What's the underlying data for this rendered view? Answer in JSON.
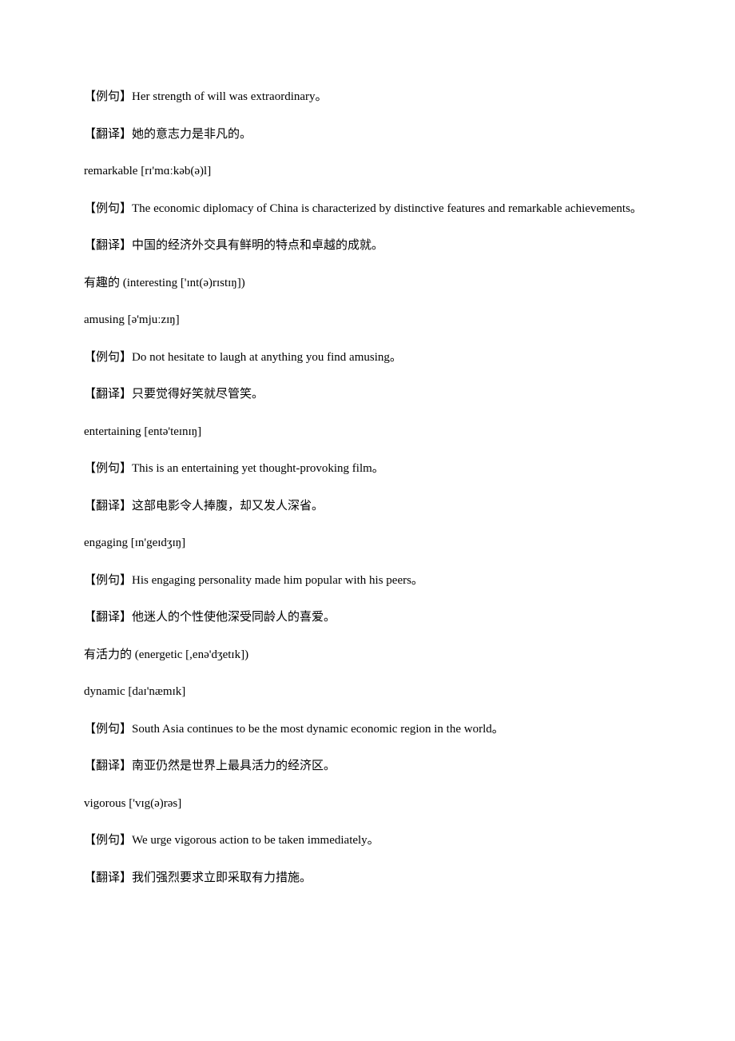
{
  "lines": [
    "【例句】Her strength of will was extraordinary。",
    "【翻译】她的意志力是非凡的。",
    "remarkable [rɪ'mɑːkəb(ə)l]",
    "【例句】The economic diplomacy of China is characterized by distinctive features and remarkable achievements。",
    "【翻译】中国的经济外交具有鲜明的特点和卓越的成就。",
    "有趣的 (interesting ['ɪnt(ə)rɪstɪŋ])",
    "amusing [ə'mjuːzɪŋ]",
    "【例句】Do not hesitate to laugh at anything you find amusing。",
    "【翻译】只要觉得好笑就尽管笑。",
    "entertaining [entə'teɪnɪŋ]",
    "【例句】This is an entertaining yet thought-provoking film。",
    "【翻译】这部电影令人捧腹，却又发人深省。",
    "engaging [ɪn'geɪdʒɪŋ]",
    "【例句】His engaging personality made him popular with his peers。",
    "【翻译】他迷人的个性使他深受同龄人的喜爱。",
    "有活力的 (energetic [,enə'dʒetɪk])",
    "dynamic [daɪ'næmɪk]",
    "【例句】South Asia continues to be the most dynamic economic region in the world。",
    "【翻译】南亚仍然是世界上最具活力的经济区。",
    "vigorous ['vɪg(ə)rəs]",
    "【例句】We urge vigorous action to be taken immediately。",
    "【翻译】我们强烈要求立即采取有力措施。"
  ]
}
